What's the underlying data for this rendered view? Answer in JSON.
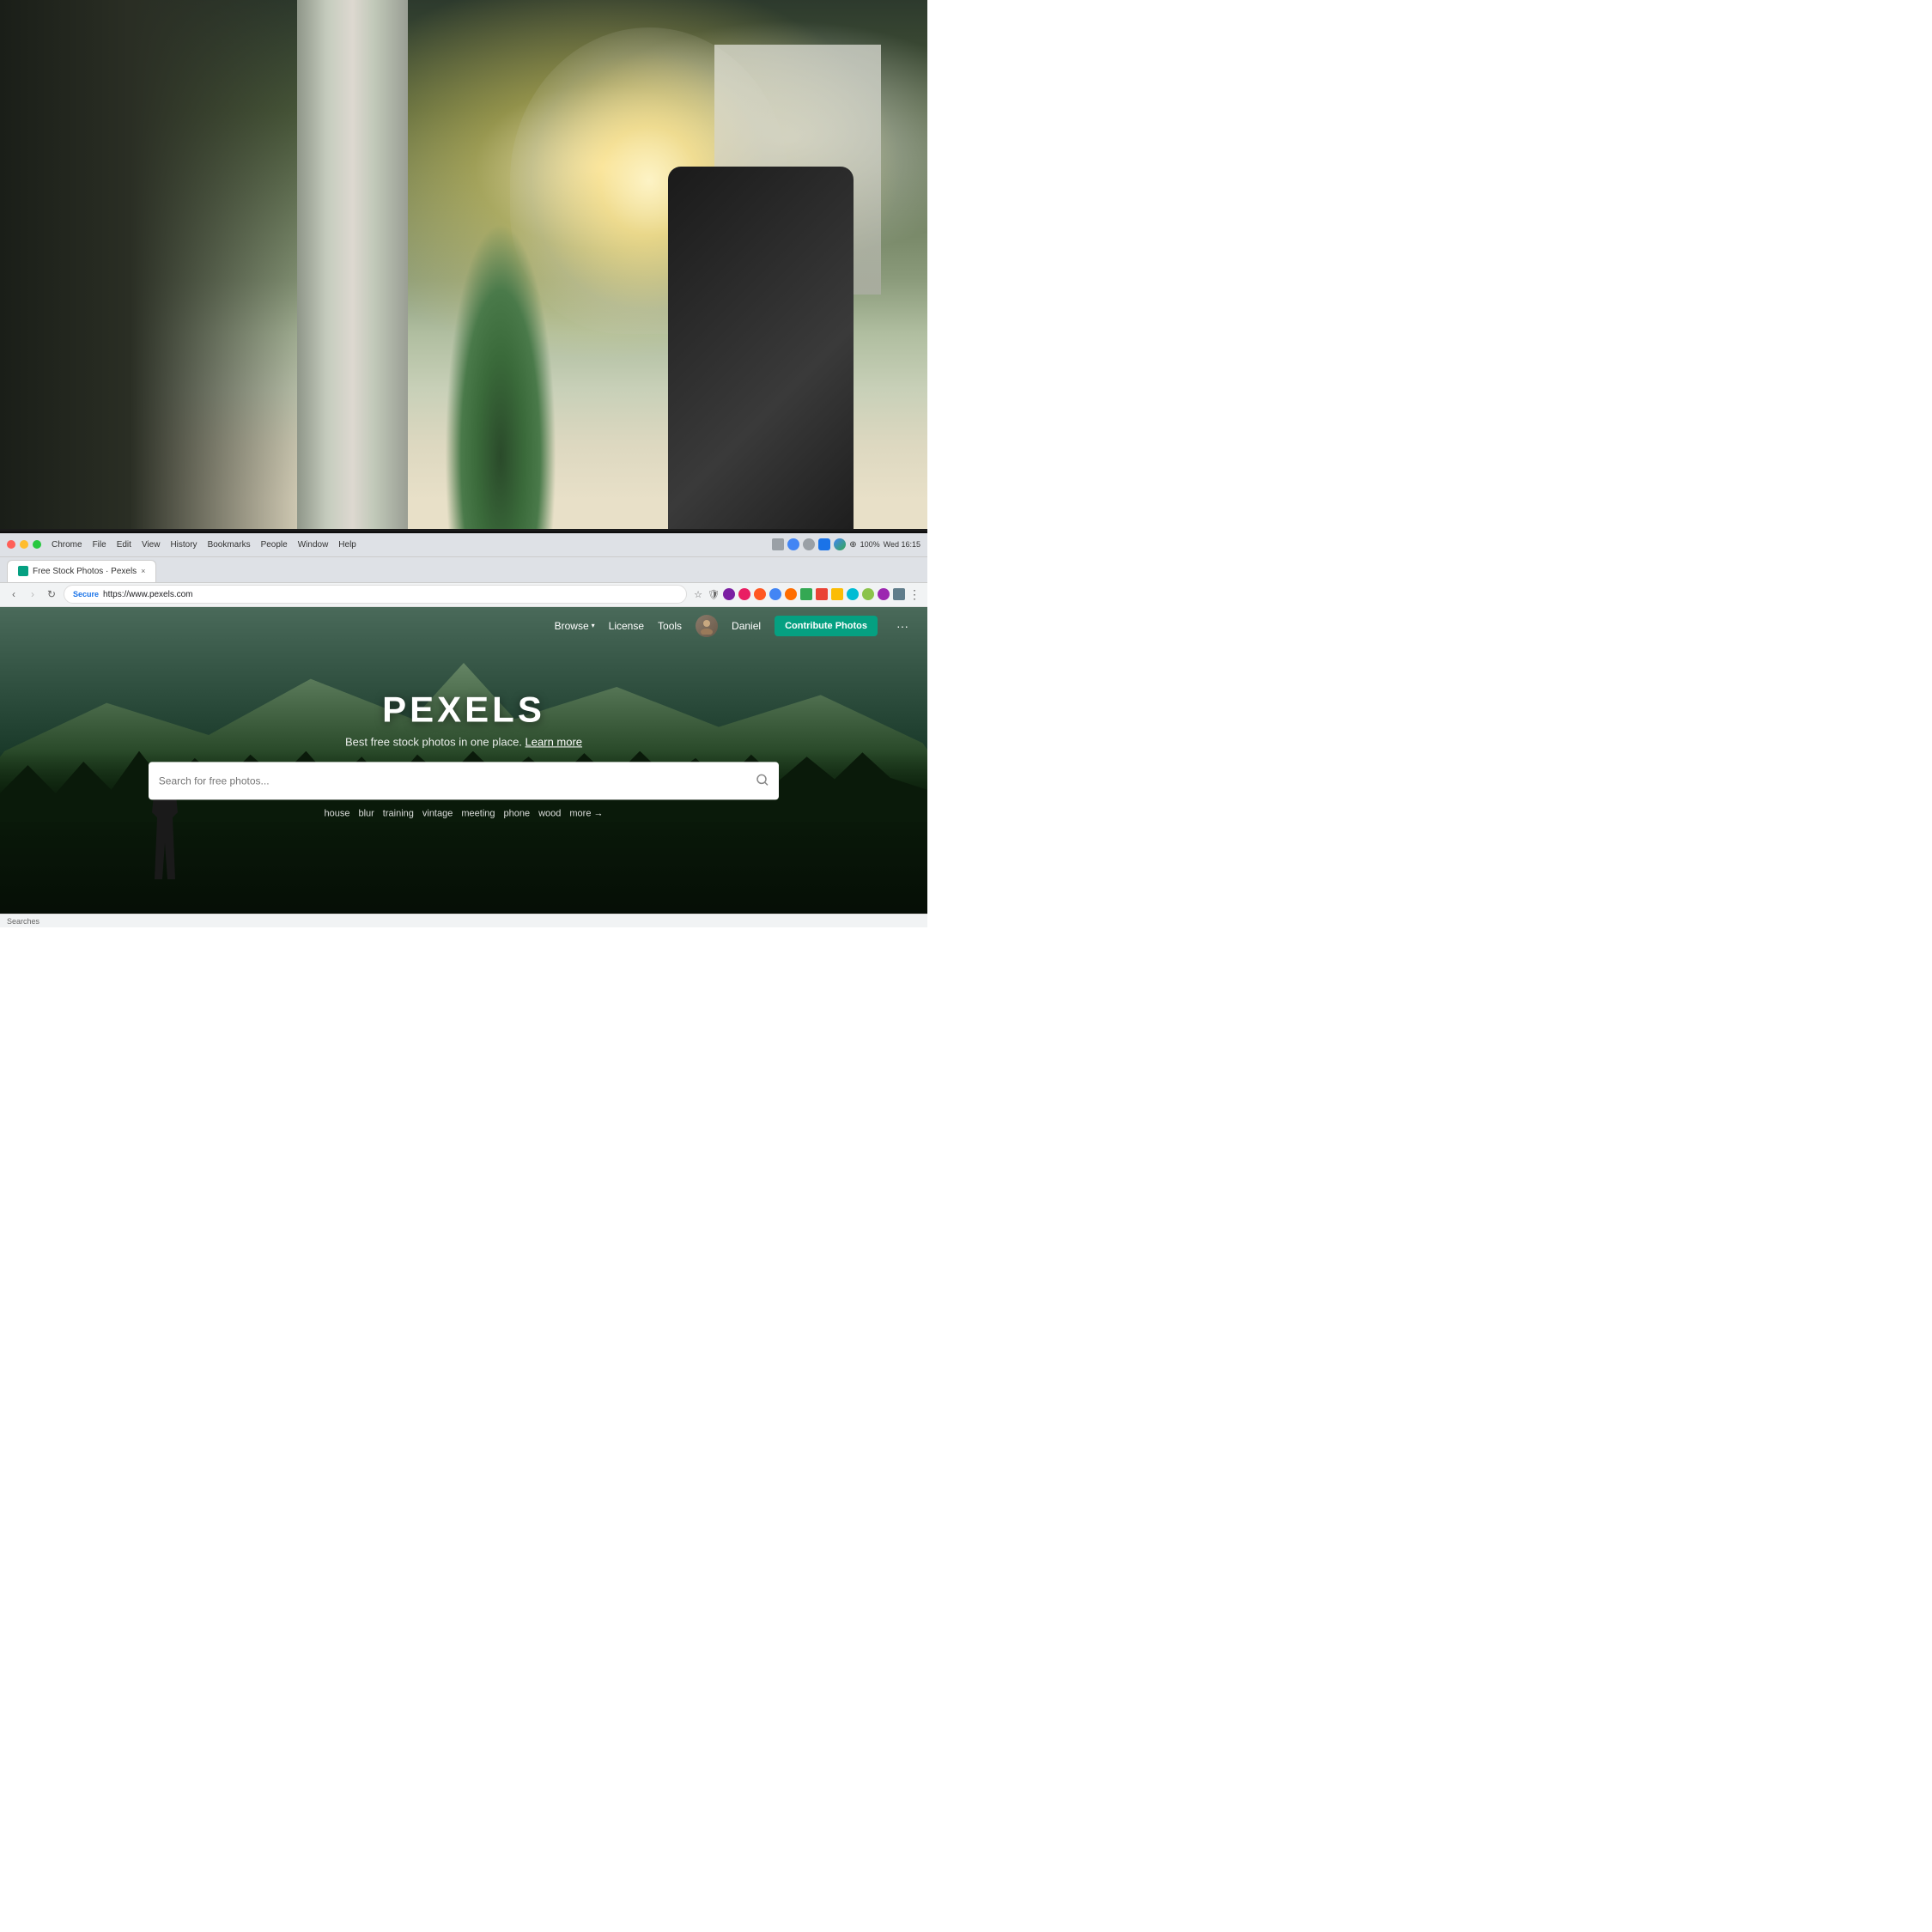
{
  "photo_background": {
    "description": "Office space background photo - blurred"
  },
  "monitor": {
    "description": "Computer monitor showing browser"
  },
  "chrome": {
    "menu_items": [
      "Chrome",
      "File",
      "Edit",
      "View",
      "History",
      "Bookmarks",
      "People",
      "Window",
      "Help"
    ],
    "time": "Wed 16:15",
    "battery": "100%",
    "tab": {
      "favicon_color": "#05a081",
      "title": "Free Stock Photos · Pexels",
      "close_label": "×"
    },
    "address": {
      "secure_label": "Secure",
      "url": "https://www.pexels.com"
    },
    "status_bar": {
      "text": "Searches"
    }
  },
  "pexels": {
    "nav": {
      "browse_label": "Browse",
      "license_label": "License",
      "tools_label": "Tools",
      "username": "Daniel",
      "contribute_label": "Contribute Photos",
      "more_label": "···"
    },
    "hero": {
      "logo": "PEXELS",
      "subtitle": "Best free stock photos in one place.",
      "learn_more": "Learn more",
      "search_placeholder": "Search for free photos...",
      "tags": [
        "house",
        "blur",
        "training",
        "vintage",
        "meeting",
        "phone",
        "wood",
        "more →"
      ]
    }
  }
}
